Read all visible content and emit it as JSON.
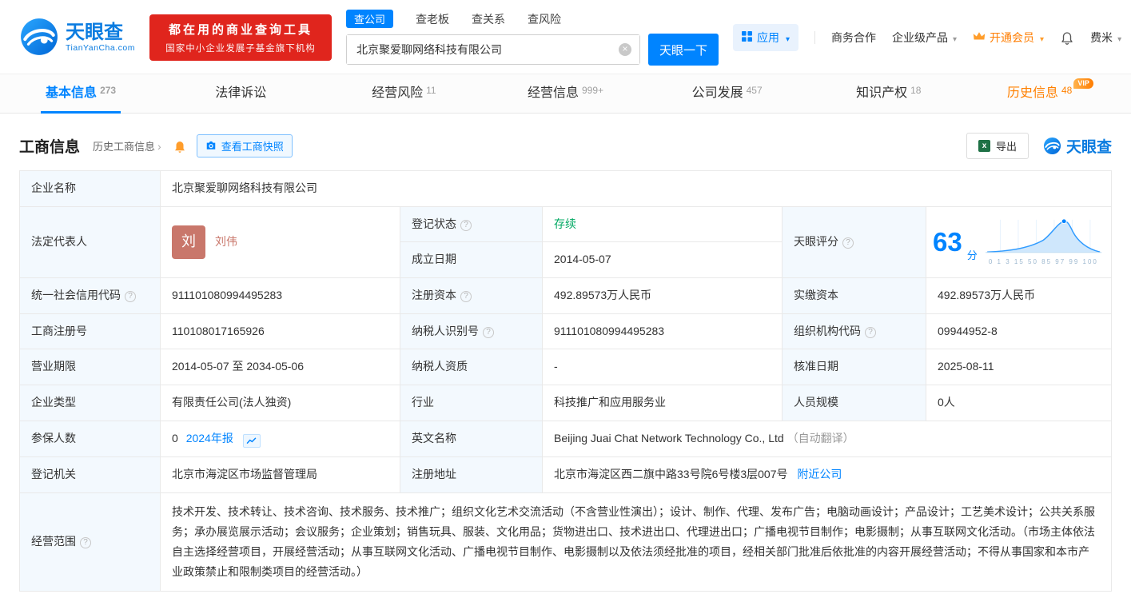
{
  "colors": {
    "brand_blue": "#0084ff",
    "vip_orange": "#ff8000",
    "status_green": "#00a862",
    "banner_red": "#e0251d",
    "avatar_red": "#c9776b"
  },
  "header": {
    "logo": {
      "brand": "天眼查",
      "domain": "TianYanCha.com"
    },
    "banner": {
      "line1": "都在用的商业查询工具",
      "line2": "国家中小企业发展子基金旗下机构"
    },
    "search_tabs": [
      {
        "label": "查公司"
      },
      {
        "label": "查老板"
      },
      {
        "label": "查关系"
      },
      {
        "label": "查风险"
      }
    ],
    "search": {
      "value": "北京聚爱聊网络科技有限公司",
      "button_label": "天眼一下"
    },
    "menu": {
      "apps": "应用",
      "cooperation": "商务合作",
      "enterprise": "企业级产品",
      "vip": "开通会员",
      "user": "费米"
    }
  },
  "nav_tabs": [
    {
      "label": "基本信息",
      "count": "273"
    },
    {
      "label": "法律诉讼",
      "count": ""
    },
    {
      "label": "经营风险",
      "count": "11"
    },
    {
      "label": "经营信息",
      "count": "999+"
    },
    {
      "label": "公司发展",
      "count": "457"
    },
    {
      "label": "知识产权",
      "count": "18"
    },
    {
      "label": "历史信息",
      "count": "48",
      "badge": "VIP"
    }
  ],
  "section": {
    "title": "工商信息",
    "history_link": "历史工商信息",
    "snapshot_button": "查看工商快照",
    "export_button": "导出",
    "watermark": "天眼查"
  },
  "info": {
    "company_name": {
      "label": "企业名称",
      "value": "北京聚爱聊网络科技有限公司"
    },
    "legal_rep": {
      "label": "法定代表人",
      "value": "刘伟",
      "avatar": "刘"
    },
    "reg_status": {
      "label": "登记状态",
      "value": "存续"
    },
    "establish_date": {
      "label": "成立日期",
      "value": "2014-05-07"
    },
    "score": {
      "label": "天眼评分"
    },
    "credit_code": {
      "label": "统一社会信用代码",
      "value": "911101080994495283"
    },
    "reg_capital": {
      "label": "注册资本",
      "value": "492.89573万人民币"
    },
    "paid_capital": {
      "label": "实缴资本",
      "value": "492.89573万人民币"
    },
    "reg_number": {
      "label": "工商注册号",
      "value": "110108017165926"
    },
    "taxpayer_id": {
      "label": "纳税人识别号",
      "value": "911101080994495283"
    },
    "org_code": {
      "label": "组织机构代码",
      "value": "09944952-8"
    },
    "business_term": {
      "label": "营业期限",
      "value": "2014-05-07 至 2034-05-06"
    },
    "taxpayer_quality": {
      "label": "纳税人资质",
      "value": "-"
    },
    "approval_date": {
      "label": "核准日期",
      "value": "2025-08-11"
    },
    "company_type": {
      "label": "企业类型",
      "value": "有限责任公司(法人独资)"
    },
    "industry": {
      "label": "行业",
      "value": "科技推广和应用服务业"
    },
    "staff_size": {
      "label": "人员规模",
      "value": "0人"
    },
    "insured": {
      "label": "参保人数",
      "value": "0",
      "report_link": "2024年报"
    },
    "english_name": {
      "label": "英文名称",
      "value": "Beijing Juai Chat Network Technology Co., Ltd",
      "note": "（自动翻译）"
    },
    "reg_authority": {
      "label": "登记机关",
      "value": "北京市海淀区市场监督管理局"
    },
    "reg_address": {
      "label": "注册地址",
      "value": "北京市海淀区西二旗中路33号院6号楼3层007号",
      "nearby_link": "附近公司"
    },
    "business_scope": {
      "label": "经营范围",
      "value": "技术开发、技术转让、技术咨询、技术服务、技术推广；组织文化艺术交流活动（不含营业性演出）；设计、制作、代理、发布广告；电脑动画设计；产品设计；工艺美术设计；公共关系服务；承办展览展示活动；会议服务；企业策划；销售玩具、服装、文化用品；货物进出口、技术进出口、代理进出口；广播电视节目制作；电影摄制；从事互联网文化活动。（市场主体依法自主选择经营项目，开展经营活动；从事互联网文化活动、广播电视节目制作、电影摄制以及依法须经批准的项目，经相关部门批准后依批准的内容开展经营活动；不得从事国家和本市产业政策禁止和限制类项目的经营活动。）"
    }
  },
  "score_chart": {
    "value": "63",
    "unit": "分",
    "ticks": "0 1 3 15 50 85 97 99 100"
  }
}
